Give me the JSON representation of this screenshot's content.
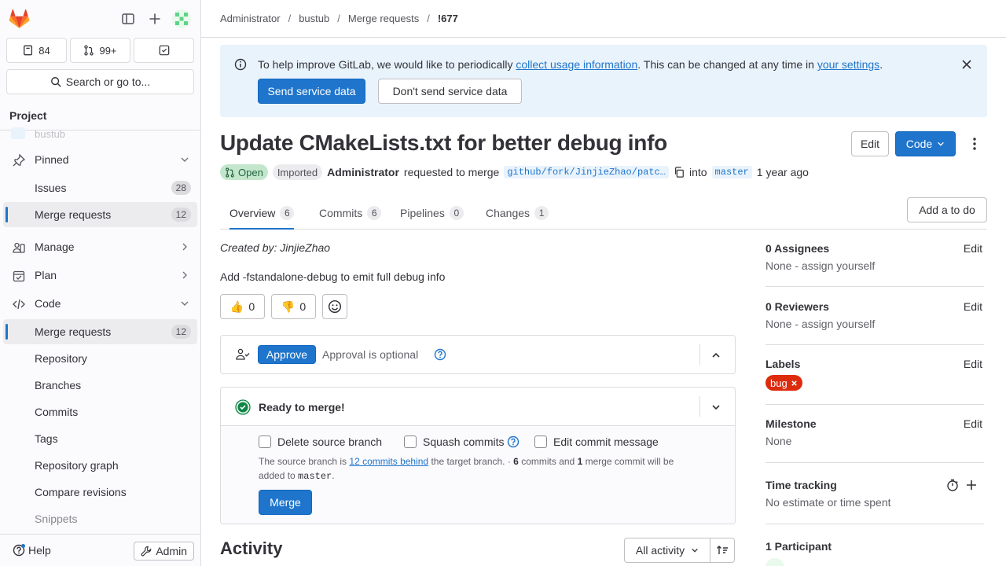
{
  "sidebar": {
    "counts": [
      {
        "icon": "issues-icon",
        "value": "84"
      },
      {
        "icon": "merge-request-icon",
        "value": "99+"
      },
      {
        "icon": "todo-icon",
        "value": ""
      }
    ],
    "search_label": "Search or go to...",
    "section_title": "Project",
    "project_stub": "bustub",
    "items": [
      {
        "label": "Pinned"
      },
      {
        "label": "Issues",
        "badge": "28"
      },
      {
        "label": "Merge requests",
        "badge": "12"
      },
      {
        "label": "Manage"
      },
      {
        "label": "Plan"
      },
      {
        "label": "Code"
      },
      {
        "label": "Merge requests",
        "badge": "12"
      },
      {
        "label": "Repository"
      },
      {
        "label": "Branches"
      },
      {
        "label": "Commits"
      },
      {
        "label": "Tags"
      },
      {
        "label": "Repository graph"
      },
      {
        "label": "Compare revisions"
      },
      {
        "label": "Snippets"
      }
    ],
    "help_label": "Help",
    "admin_label": "Admin"
  },
  "breadcrumb": [
    "Administrator",
    "bustub",
    "Merge requests",
    "!677"
  ],
  "banner": {
    "text_before": "To help improve GitLab, we would like to periodically ",
    "link1": "collect usage information",
    "text_middle": ". This can be changed at any time in ",
    "link2": "your settings",
    "text_after": ".",
    "send_label": "Send service data",
    "dont_send_label": "Don't send service data"
  },
  "mr": {
    "title": "Update CMakeLists.txt for better debug info",
    "edit_label": "Edit",
    "code_label": "Code",
    "status": "Open",
    "imported": "Imported",
    "author": "Administrator",
    "requested_text": "requested to merge",
    "source_branch": "github/fork/JinjieZhao/patc…",
    "into_text": "into",
    "target_branch": "master",
    "time": "1 year ago"
  },
  "tabs": [
    {
      "label": "Overview",
      "count": "6"
    },
    {
      "label": "Commits",
      "count": "6"
    },
    {
      "label": "Pipelines",
      "count": "0"
    },
    {
      "label": "Changes",
      "count": "1"
    }
  ],
  "add_todo_label": "Add a to do",
  "overview": {
    "created_by": "Created by: JinjieZhao",
    "description": "Add -fstandalone-debug to emit full debug info",
    "thumbs_up": "👍",
    "thumbs_up_count": "0",
    "thumbs_down": "👎",
    "thumbs_down_count": "0"
  },
  "approval": {
    "approve_label": "Approve",
    "optional_text": "Approval is optional"
  },
  "merge": {
    "ready_text": "Ready to merge!",
    "delete_source": "Delete source branch",
    "squash": "Squash commits",
    "edit_message": "Edit commit message",
    "info_1": "The source branch is ",
    "behind_link": "12 commits behind",
    "info_2": " the target branch. · ",
    "commits_n": "6",
    "info_3": " commits and ",
    "merge_n": "1",
    "info_4": " merge commit will be added to ",
    "target": "master",
    "info_5": ".",
    "merge_label": "Merge"
  },
  "activity": {
    "title": "Activity",
    "filter_label": "All activity"
  },
  "right": {
    "assignees_title": "0 Assignees",
    "assignees_value": "None - assign yourself",
    "reviewers_title": "0 Reviewers",
    "reviewers_value": "None - assign yourself",
    "labels_title": "Labels",
    "label_bug": "bug",
    "milestone_title": "Milestone",
    "milestone_value": "None",
    "time_title": "Time tracking",
    "time_value": "No estimate or time spent",
    "participants_title": "1 Participant",
    "edit": "Edit"
  },
  "colors": {
    "accent": "#1f75cb",
    "success": "#108548",
    "danger": "#dd2b0e"
  }
}
